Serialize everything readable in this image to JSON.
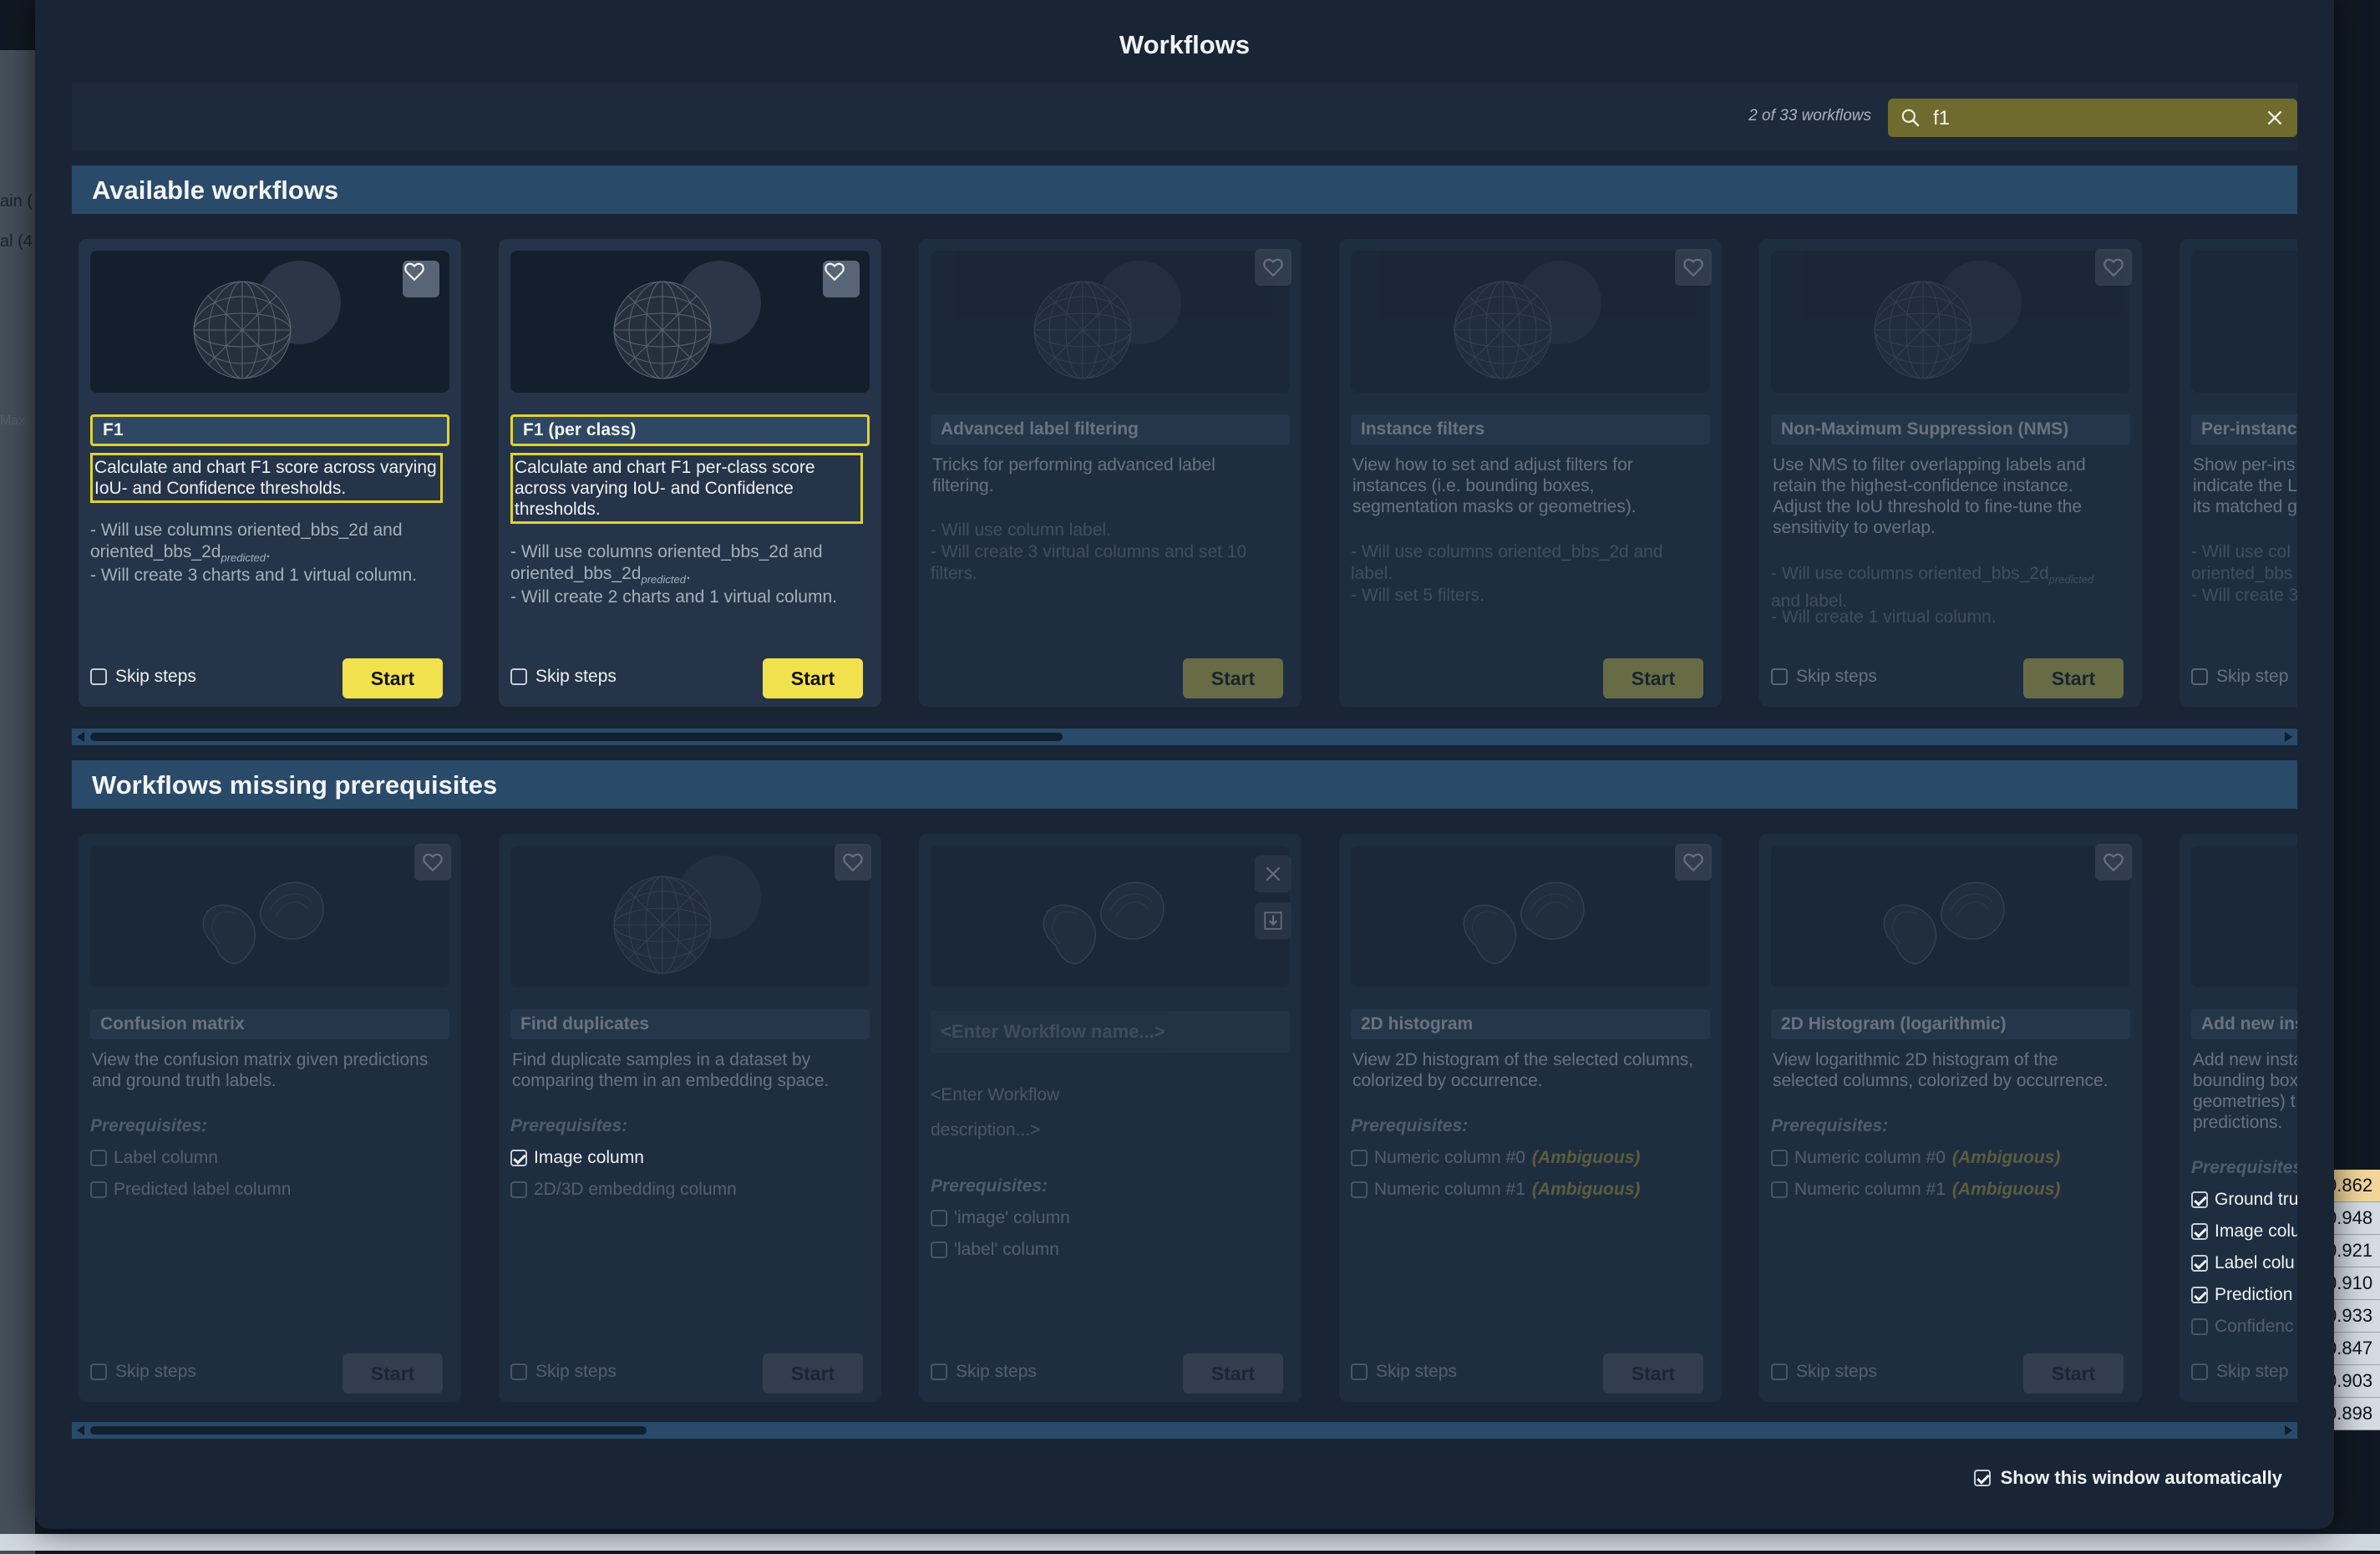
{
  "background": {
    "left_texts": [
      "ain (",
      "al (4",
      "Max"
    ],
    "right_values": [
      "0.862",
      "0.948",
      "0.921",
      "0.910",
      "0.933",
      "0.847",
      "0.903",
      "0.898"
    ]
  },
  "modal": {
    "title": "Workflows",
    "count_text": "2 of 33 workflows",
    "search_value": "f1",
    "footer_label": "Show this window automatically"
  },
  "available": {
    "heading": "Available workflows",
    "cards": [
      {
        "title": "F1",
        "desc": "Calculate and chart F1 score across varying IoU- and Confidence thresholds.",
        "note1a": "- Will use columns oriented_bbs_2d and oriented_bbs_2d",
        "note1sub": "predicted",
        "note2": "- Will create 3 charts and 1 virtual column.",
        "skip": "Skip steps",
        "start": "Start"
      },
      {
        "title": "F1 (per class)",
        "desc": "Calculate and chart F1 per-class score across varying IoU- and Confidence thresholds.",
        "note1a": "- Will use columns oriented_bbs_2d and oriented_bbs_2d",
        "note1sub": "predicted",
        "note2": "- Will create 2 charts and 1 virtual column.",
        "skip": "Skip steps",
        "start": "Start"
      },
      {
        "title": "Advanced label filtering",
        "desc": "Tricks for performing advanced label filtering.",
        "note1": "- Will use column label.",
        "note2": "- Will create 3 virtual columns and set 10 filters.",
        "start": "Start"
      },
      {
        "title": "Instance filters",
        "desc": "View how to set and adjust filters for instances (i.e. bounding boxes, segmentation masks or geometries).",
        "note1": "- Will use columns oriented_bbs_2d and label.",
        "note2": "- Will set 5 filters.",
        "start": "Start"
      },
      {
        "title": "Non-Maximum Suppression (NMS)",
        "desc": "Use NMS to filter overlapping labels and retain the highest-confidence instance. Adjust the IoU threshold to fine-tune the sensitivity to overlap.",
        "note1a": "- Will use columns oriented_bbs_2d",
        "note1sub": "predicted",
        "note1b": "and label.",
        "note2": "- Will create 1 virtual column.",
        "skip": "Skip steps",
        "start": "Start"
      },
      {
        "title": "Per-instanc",
        "desc": "Show per-ins indicate the L its matched g",
        "note1": "- Will use col oriented_bbs",
        "note2": "- Will create 3",
        "skip": "Skip step"
      }
    ]
  },
  "missing": {
    "heading": "Workflows missing prerequisites",
    "prereq_label": "Prerequisites:",
    "cards": [
      {
        "title": "Confusion matrix",
        "desc": "View the confusion matrix given predictions and ground truth labels.",
        "prereqs": [
          {
            "label": "Label column",
            "checked": false
          },
          {
            "label": "Predicted label column",
            "checked": false
          }
        ],
        "skip": "Skip steps",
        "start": "Start"
      },
      {
        "title": "Find duplicates",
        "desc": "Find duplicate samples in a dataset by comparing them in an embedding space.",
        "prereqs": [
          {
            "label": "Image column",
            "checked": true
          },
          {
            "label": "2D/3D embedding column",
            "checked": false
          }
        ],
        "skip": "Skip steps",
        "start": "Start"
      },
      {
        "title_placeholder": "<Enter Workflow name...>",
        "desc_placeholder": "<Enter Workflow description...>",
        "prereqs": [
          {
            "label": "'image' column",
            "checked": false
          },
          {
            "label": "'label' column",
            "checked": false
          }
        ],
        "skip": "Skip steps",
        "start": "Start"
      },
      {
        "title": "2D histogram",
        "desc": "View 2D histogram of the selected columns, colorized by occurrence.",
        "prereqs": [
          {
            "label": "Numeric column #0",
            "amb": "(Ambiguous)",
            "checked": false
          },
          {
            "label": "Numeric column #1",
            "amb": "(Ambiguous)",
            "checked": false
          }
        ],
        "skip": "Skip steps",
        "start": "Start"
      },
      {
        "title": "2D Histogram (logarithmic)",
        "desc": "View logarithmic 2D histogram of the selected columns, colorized by occurrence.",
        "prereqs": [
          {
            "label": "Numeric column #0",
            "amb": "(Ambiguous)",
            "checked": false
          },
          {
            "label": "Numeric column #1",
            "amb": "(Ambiguous)",
            "checked": false
          }
        ],
        "skip": "Skip steps",
        "start": "Start"
      },
      {
        "title": "Add new ins",
        "desc": "Add new insta bounding box geometries) t predictions.",
        "prereq_label": "Prerequisites",
        "prereqs": [
          {
            "label": "Ground tru",
            "checked": true
          },
          {
            "label": "Image colu",
            "checked": true
          },
          {
            "label": "Label colu",
            "checked": true
          },
          {
            "label": "Prediction",
            "checked": true
          },
          {
            "label": "Confidenc",
            "checked": false
          }
        ],
        "skip": "Skip step"
      }
    ]
  },
  "icons": [
    "search-icon",
    "close-icon",
    "heart-icon",
    "download-icon"
  ],
  "colors": {
    "accent": "#f1e24d",
    "section": "#2a4a69",
    "modal": "#192535"
  }
}
